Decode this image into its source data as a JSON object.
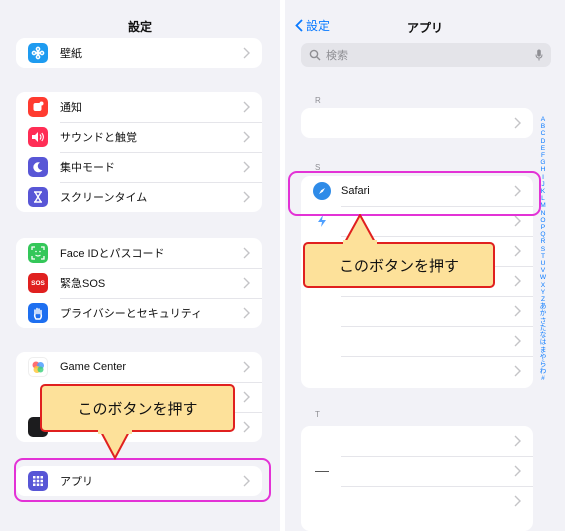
{
  "left": {
    "title": "設定",
    "rows": [
      {
        "label": "壁紙",
        "icon": "wallpaper-icon",
        "color": "#1e9bf0"
      },
      {
        "label": "通知",
        "icon": "bell-icon",
        "color": "#ff3b30"
      },
      {
        "label": "サウンドと触覚",
        "icon": "speaker-icon",
        "color": "#ff2d55"
      },
      {
        "label": "集中モード",
        "icon": "moon-icon",
        "color": "#5856d6"
      },
      {
        "label": "スクリーンタイム",
        "icon": "hourglass-icon",
        "color": "#5856d6"
      },
      {
        "label": "Face IDとパスコード",
        "icon": "face-id-icon",
        "color": "#34c759"
      },
      {
        "label": "緊急SOS",
        "icon": "sos-icon",
        "color": "#e0201f",
        "icon_text": "SOS"
      },
      {
        "label": "プライバシーとセキュリティ",
        "icon": "hand-icon",
        "color": "#1e6ff0"
      },
      {
        "label": "Game Center",
        "icon": "game-center-icon",
        "color": "#ffffff"
      },
      {
        "label": "アプリ",
        "icon": "apps-grid-icon",
        "color": "#5856d6"
      }
    ],
    "callout": "このボタンを押す"
  },
  "right": {
    "back_label": "設定",
    "title": "アプリ",
    "search_placeholder": "検索",
    "section_r": "R",
    "section_s": "S",
    "section_t": "T",
    "safari_label": "Safari",
    "callout": "このボタンを押す",
    "index": [
      "A",
      "B",
      "C",
      "D",
      "E",
      "F",
      "G",
      "H",
      "I",
      "J",
      "K",
      "L",
      "M",
      "N",
      "O",
      "P",
      "Q",
      "R",
      "S",
      "T",
      "U",
      "V",
      "W",
      "X",
      "Y",
      "Z",
      "あ",
      "か",
      "さ",
      "た",
      "な",
      "は",
      "ま",
      "や",
      "ら",
      "わ",
      "#"
    ]
  },
  "colors": {
    "accent": "#0a7aff",
    "highlight": "#e332d6",
    "callout_fill": "#fde19a",
    "callout_border": "#e0201f"
  }
}
